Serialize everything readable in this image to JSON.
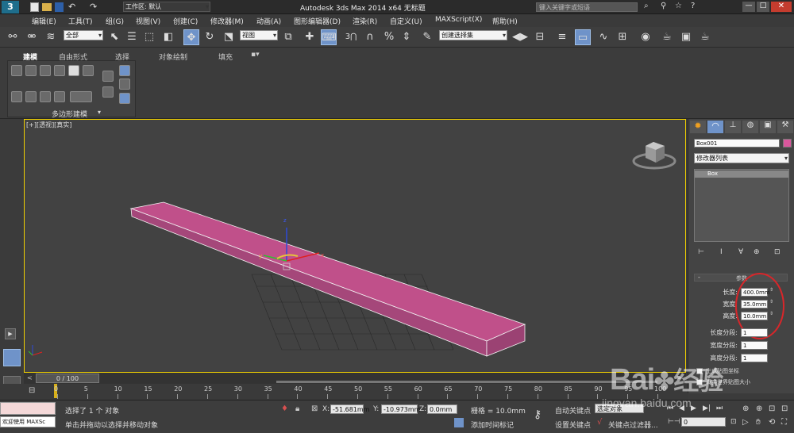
{
  "titlebar": {
    "workspace": "工作区: 默认",
    "title": "Autodesk 3ds Max  2014 x64     无标题",
    "search_placeholder": "键入关键字或短语"
  },
  "menu": [
    "编辑(E)",
    "工具(T)",
    "组(G)",
    "视图(V)",
    "创建(C)",
    "修改器(M)",
    "动画(A)",
    "图形编辑器(D)",
    "渲染(R)",
    "自定义(U)",
    "MAXScript(X)",
    "帮助(H)"
  ],
  "toolbar": {
    "selection_filter": "全部",
    "ref_coord": "视图",
    "named_selection": "创建选择集"
  },
  "ribbon": {
    "tabs": [
      "建模",
      "自由形式",
      "选择",
      "对象绘制",
      "填充"
    ],
    "panel_label": "多边形建模"
  },
  "viewport": {
    "label": "[+][透视][真实]"
  },
  "cmdpanel": {
    "object_name": "Box001",
    "object_color": "#d9579c",
    "modifier_list": "修改器列表",
    "stack_item": "Box",
    "rollout_title": "参数",
    "params": [
      {
        "label": "长度:",
        "value": "400.0mm"
      },
      {
        "label": "宽度:",
        "value": "35.0mm"
      },
      {
        "label": "高度:",
        "value": "10.0mm"
      }
    ],
    "segs": [
      {
        "label": "长度分段:",
        "value": "1"
      },
      {
        "label": "宽度分段:",
        "value": "1"
      },
      {
        "label": "高度分段:",
        "value": "1"
      }
    ],
    "gen_coords": "生成贴图坐标",
    "real_world": "真实世界贴图大小"
  },
  "timeslider": {
    "frame": "0 / 100",
    "ticks": [
      "0",
      "5",
      "10",
      "15",
      "20",
      "25",
      "30",
      "35",
      "40",
      "45",
      "50",
      "55",
      "60",
      "65",
      "70",
      "75",
      "80",
      "85",
      "90",
      "95",
      "100"
    ]
  },
  "status": {
    "welcome": "欢迎使用 MAXSc",
    "selected": "选择了 1 个 对象",
    "prompt": "单击并拖动以选择并移动对象",
    "x_label": "X:",
    "x": "-51.681mm",
    "y_label": "Y:",
    "y": "-10.973mm",
    "z_label": "Z:",
    "z": "0.0mm",
    "grid": "栅格 = 10.0mm",
    "add_time_tag": "添加时间标记",
    "auto_key": "自动关键点",
    "selected_dd": "选定对象",
    "set_key": "设置关键点",
    "key_filters": "关键点过滤器...",
    "frame_field": "0"
  },
  "watermark": {
    "text1": "Bai",
    "text2": "经验",
    "url": "jingyan.baidu.com"
  }
}
